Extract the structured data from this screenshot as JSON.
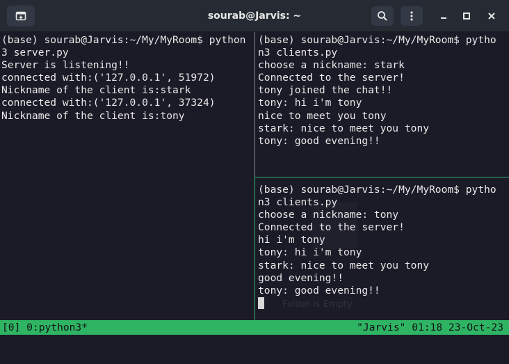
{
  "window": {
    "title": "sourab@Jarvis: ~",
    "icons": {
      "new_tab": "new-tab-icon",
      "search": "search-icon",
      "menu": "kebab-menu-icon",
      "minimize": "minimize-icon",
      "maximize": "maximize-icon",
      "close": "close-icon"
    }
  },
  "panes": {
    "left": {
      "lines": [
        "(base) sourab@Jarvis:~/My/MyRoom$ python",
        "3 server.py",
        "Server is listening!!",
        "connected with:('127.0.0.1', 51972)",
        "Nickname of the client is:stark",
        "connected with:('127.0.0.1', 37324)",
        "Nickname of the client is:tony"
      ]
    },
    "right_top": {
      "lines": [
        "(base) sourab@Jarvis:~/My/MyRoom$ pytho",
        "n3 clients.py",
        "choose a nickname: stark",
        "Connected to the server!",
        "tony joined the chat!!",
        "tony: hi i'm tony",
        "nice to meet you tony",
        "stark: nice to meet you tony",
        "tony: good evening!!"
      ]
    },
    "right_bottom": {
      "lines": [
        "(base) sourab@Jarvis:~/My/MyRoom$ pytho",
        "n3 clients.py",
        "choose a nickname: tony",
        "Connected to the server!",
        "hi i'm tony",
        "tony: hi i'm tony",
        "stark: nice to meet you tony",
        "good evening!!",
        "tony: good evening!!"
      ]
    }
  },
  "overlay": {
    "ghost_text": "Folder is Empty"
  },
  "status_bar": {
    "left": "[0] 0:python3*",
    "right": "\"Jarvis\" 01:18 23-Oct-23"
  },
  "colors": {
    "terminal_bg": "#1b1b28",
    "text": "#e8e8e8",
    "titlebar_bg": "#262b33",
    "status_bar_bg": "#2fb464",
    "active_pane_border": "#2fb070",
    "inactive_pane_border": "#8a8a8a"
  }
}
